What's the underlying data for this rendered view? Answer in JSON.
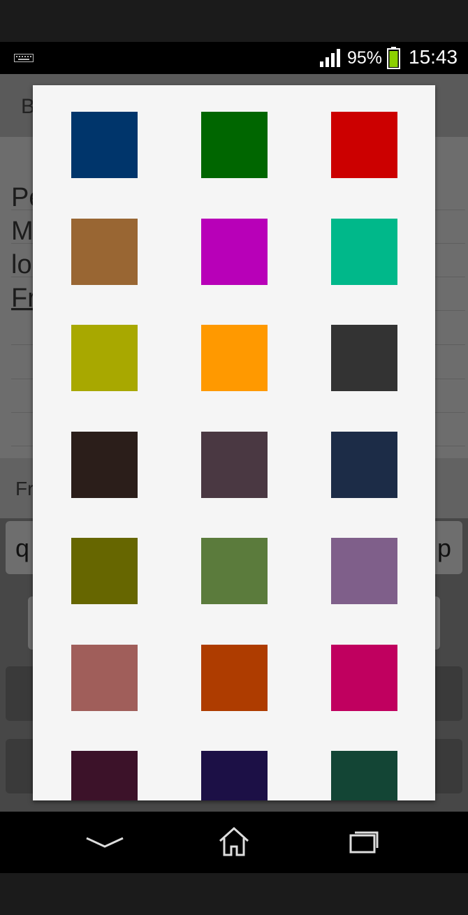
{
  "status_bar": {
    "battery_percent": "95%",
    "time": "15:43",
    "icons": [
      "keyboard-icon",
      "signal-icon",
      "battery-icon"
    ]
  },
  "background_app": {
    "app_bar_text": "B",
    "body_lines": [
      "Pe",
      "M",
      "lo",
      "Fr"
    ],
    "suggestion_text": "Fr",
    "keyboard_keys": [
      "q",
      "p"
    ]
  },
  "color_picker": {
    "rows": [
      [
        "#00356b",
        "#006600",
        "#cc0000"
      ],
      [
        "#996633",
        "#b800b8",
        "#00b88a"
      ],
      [
        "#a8a800",
        "#ff9900",
        "#333333"
      ],
      [
        "#2b1e1a",
        "#4a3842",
        "#1c2c47"
      ],
      [
        "#666600",
        "#5b7b3c",
        "#7f5f8a"
      ],
      [
        "#a05e5a",
        "#ae3c00",
        "#c0005f"
      ],
      [
        "#3c1229",
        "#1c1046",
        "#134535"
      ]
    ]
  },
  "nav_bar": {
    "icons": [
      "back-icon",
      "home-icon",
      "recent-apps-icon"
    ]
  }
}
